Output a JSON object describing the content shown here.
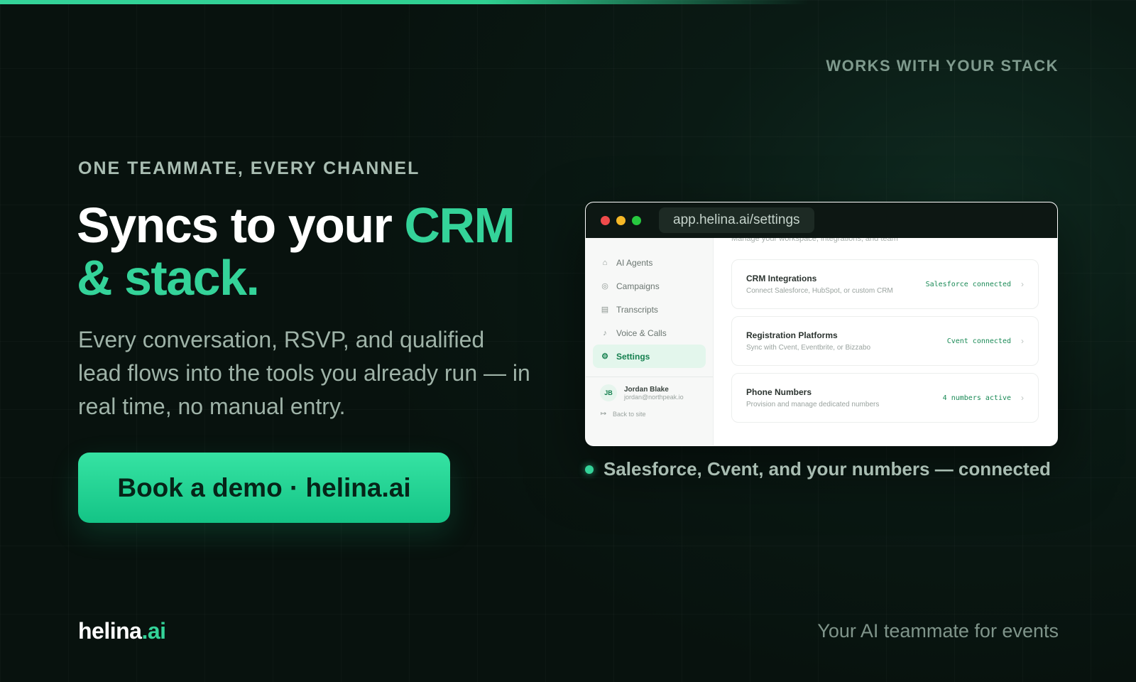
{
  "header": {
    "works_label": "WORKS WITH YOUR STACK"
  },
  "hero": {
    "eyebrow": "ONE TEAMMATE, EVERY CHANNEL",
    "headline_plain": "Syncs to your ",
    "headline_accent": "CRM & stack.",
    "subcopy": "Every conversation, RSVP, and qualified lead flows into the tools you already run — in real time, no manual entry.",
    "cta_label": "Book a demo · helina.ai"
  },
  "browser": {
    "url": "app.helina.ai/settings",
    "main_subtitle": "Manage your workspace, integrations, and team",
    "sidebar": {
      "items": [
        {
          "label": "AI Agents",
          "icon": "robot-icon",
          "glyph": "⌂"
        },
        {
          "label": "Campaigns",
          "icon": "target-icon",
          "glyph": "◎"
        },
        {
          "label": "Transcripts",
          "icon": "document-icon",
          "glyph": "▤"
        },
        {
          "label": "Voice & Calls",
          "icon": "microphone-icon",
          "glyph": "♪"
        },
        {
          "label": "Settings",
          "icon": "gear-icon",
          "glyph": "⚙",
          "active": true
        }
      ],
      "user": {
        "initials": "JB",
        "name": "Jordan Blake",
        "email": "jordan@northpeak.io"
      },
      "back_label": "Back to site"
    },
    "cards": [
      {
        "title": "CRM Integrations",
        "desc": "Connect Salesforce, HubSpot, or custom CRM",
        "status": "Salesforce connected"
      },
      {
        "title": "Registration Platforms",
        "desc": "Sync with Cvent, Eventbrite, or Bizzabo",
        "status": "Cvent connected"
      },
      {
        "title": "Phone Numbers",
        "desc": "Provision and manage dedicated numbers",
        "status": "4 numbers active"
      }
    ]
  },
  "caption": "Salesforce, Cvent, and your numbers — connected",
  "footer": {
    "logo_name": "helina",
    "logo_tld": ".ai",
    "tagline": "Your AI teammate for events"
  },
  "colors": {
    "accent": "#34d399",
    "background": "#0a1a14"
  }
}
